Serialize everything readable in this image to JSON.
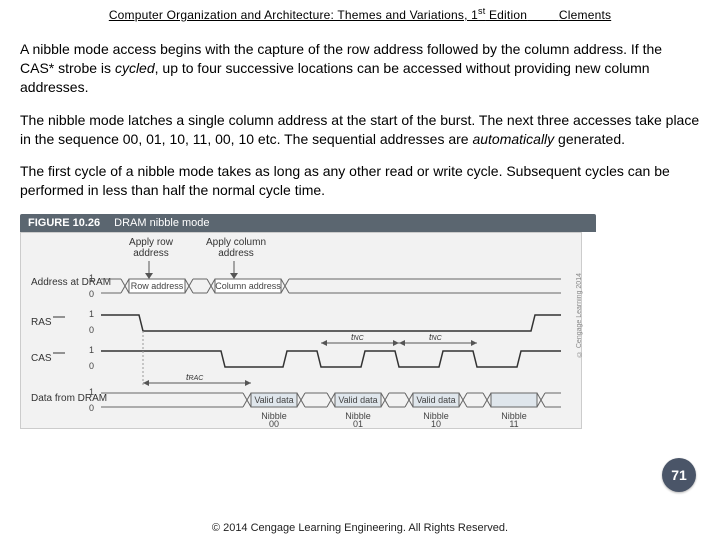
{
  "header": {
    "book_title": "Computer Organization and Architecture: Themes and Variations, 1",
    "edition_suffix": "st",
    "edition_word": " Edition",
    "author": "Clements"
  },
  "paragraphs": {
    "p1_a": "A nibble mode access begins with the capture of the row address followed by the column address. If the CAS* strobe is ",
    "p1_italic": "cycled",
    "p1_b": ", up to four successive locations can be accessed without providing new column addresses.",
    "p2_a": "The nibble mode latches a single column address at the start of the burst. The next three accesses take place in the sequence 00, 01, 10, 11, 00, 10 etc. The sequential addresses are ",
    "p2_italic": "automatically",
    "p2_b": " generated.",
    "p3": "The first cycle of a nibble mode takes as long as any other read or write cycle. Subsequent cycles can be performed in less than half the normal cycle time."
  },
  "figure": {
    "label": "FIGURE 10.26",
    "title": "DRAM nibble mode",
    "apply_row": "Apply row address",
    "apply_col": "Apply column address",
    "signals": {
      "addr": "Address at DRAM",
      "ras": "RAS",
      "cas": "CAS",
      "data": "Data from DRAM"
    },
    "levels": {
      "hi": "1",
      "lo": "0"
    },
    "row_box": "Row address",
    "col_box": "Column address",
    "valid": "Valid data",
    "nibble": "Nibble",
    "seq": [
      "00",
      "01",
      "10",
      "11"
    ],
    "t_nc": "t",
    "t_nc_sub": "NC",
    "t_rac": "t",
    "t_rac_sub": "RAC",
    "side_copy": "© Cengage Learning 2014"
  },
  "page_number": "71",
  "footer": "© 2014 Cengage Learning Engineering. All Rights Reserved."
}
